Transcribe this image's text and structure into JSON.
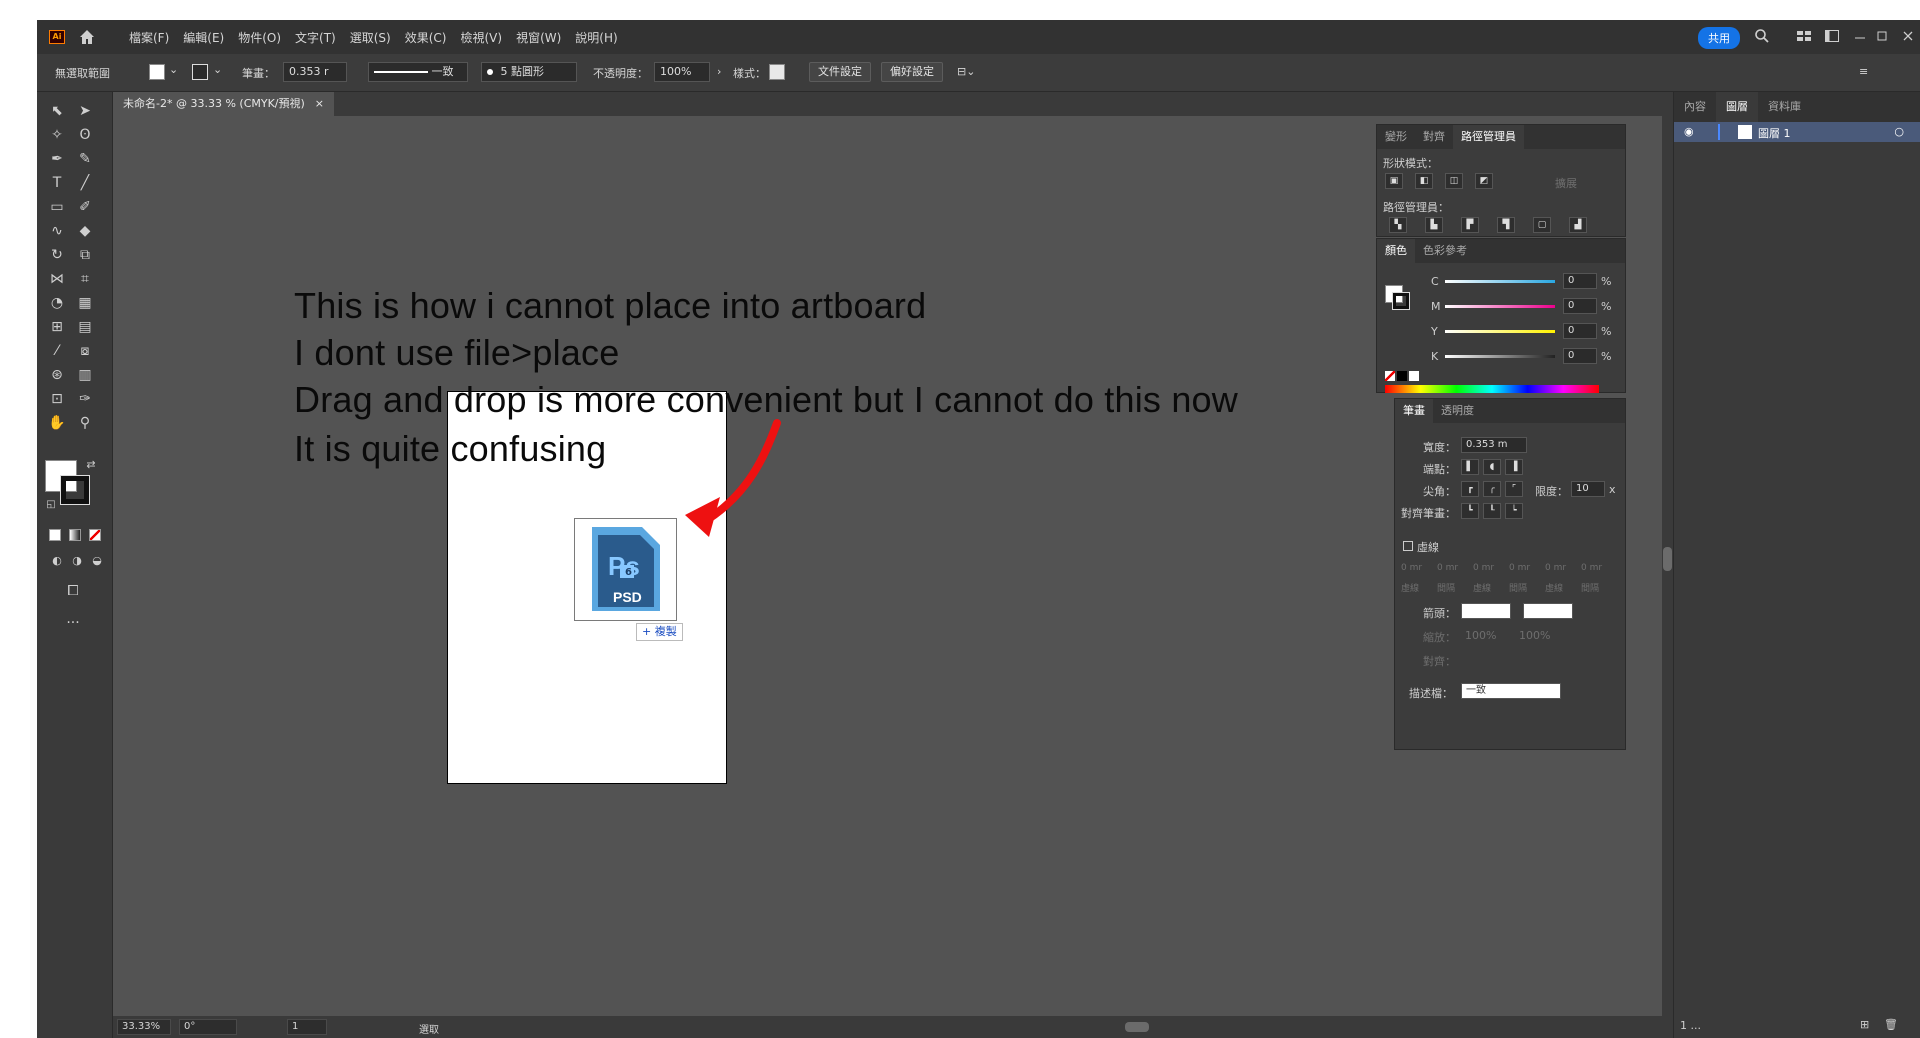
{
  "app": {
    "logo": "Ai",
    "share_label": "共用"
  },
  "menu": [
    "檔案(F)",
    "編輯(E)",
    "物件(O)",
    "文字(T)",
    "選取(S)",
    "效果(C)",
    "檢視(V)",
    "視窗(W)",
    "說明(H)"
  ],
  "control": {
    "selection": "無選取範圍",
    "stroke_label": "筆畫：",
    "stroke_value": "0.353 r",
    "profile": "一致",
    "brush": "5 點圓形",
    "opacity_label": "不透明度：",
    "opacity_value": "100%",
    "style_label": "樣式：",
    "doc_setup": "文件設定",
    "prefs": "偏好設定"
  },
  "doc_tab": {
    "title": "未命名-2* @ 33.33 % (CMYK/預視)",
    "close": "×"
  },
  "overlay_text": [
    "This is how i cannot place into artboard",
    "I dont use  file>place",
    "Drag and drop is more convenient but I cannot do this now",
    "It is quite confusing"
  ],
  "drag_icon": {
    "label": "PSD",
    "badge": "6",
    "copy_label": "+ 複製"
  },
  "pathfinder": {
    "tabs": [
      "變形",
      "對齊",
      "路徑管理員"
    ],
    "shape_modes_label": "形狀模式：",
    "expand_label": "擴展",
    "pathfinders_label": "路徑管理員："
  },
  "color": {
    "tabs": [
      "顏色",
      "色彩參考"
    ],
    "channels": [
      {
        "name": "C",
        "value": "0",
        "unit": "%",
        "color": "#29a7e1"
      },
      {
        "name": "M",
        "value": "0",
        "unit": "%",
        "color": "#ec008c"
      },
      {
        "name": "Y",
        "value": "0",
        "unit": "%",
        "color": "#fff200"
      },
      {
        "name": "K",
        "value": "0",
        "unit": "%",
        "color": "#888888"
      }
    ]
  },
  "stroke_panel": {
    "tabs": [
      "筆畫",
      "透明度"
    ],
    "weight_label": "寬度：",
    "weight_value": "0.353 m",
    "cap_label": "端點：",
    "corner_label": "尖角：",
    "limit_label": "限度：",
    "limit_value": "10",
    "limit_unit": "x",
    "align_label": "對齊筆畫：",
    "dashed_label": "虛線",
    "dash_values": [
      "0 mr",
      "0 mr",
      "0 mr",
      "0 mr",
      "0 mr",
      "0 mr"
    ],
    "dash_labels": [
      "虛線",
      "間隔",
      "虛線",
      "間隔",
      "虛線",
      "間隔"
    ],
    "arrow_label": "箭頭：",
    "scale_label": "縮放：",
    "scale_values": [
      "100%",
      "100%"
    ],
    "align_arrow_label": "對齊：",
    "profile_label": "描述檔：",
    "profile_value": "一致"
  },
  "layers": {
    "tabs": [
      "內容",
      "圖層",
      "資料庫"
    ],
    "layer_name": "圖層 1",
    "footer_count": "1 ..."
  },
  "status": {
    "zoom": "33.33%",
    "rotate": "0°",
    "artboard": "1",
    "mode": "選取"
  }
}
